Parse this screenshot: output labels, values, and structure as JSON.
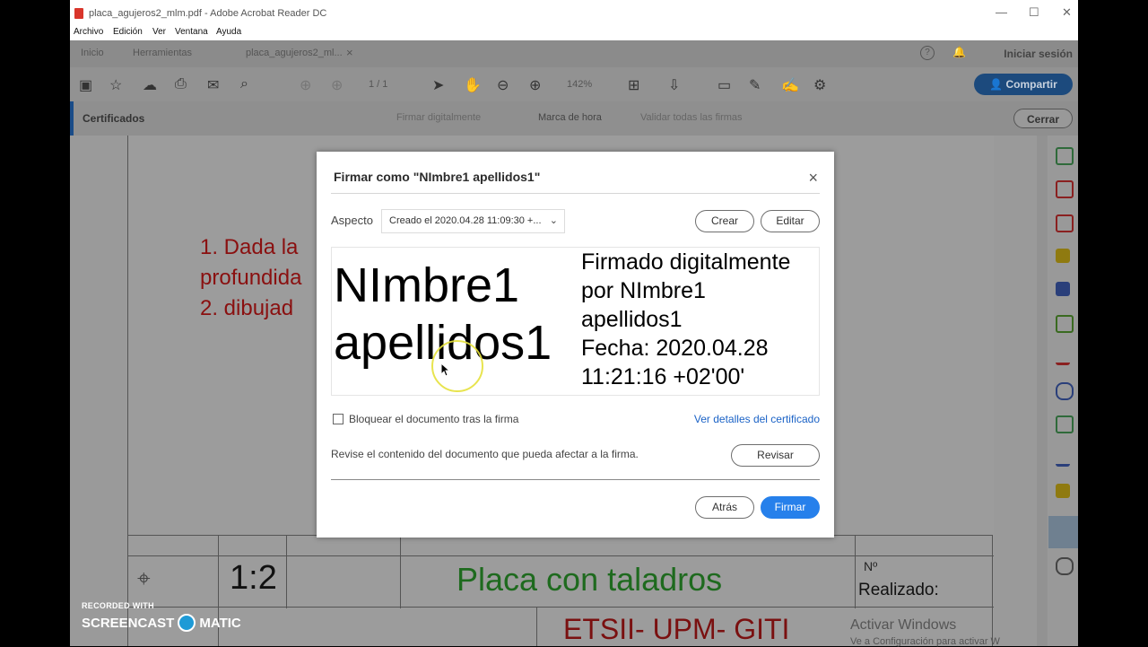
{
  "window": {
    "title": "placa_agujeros2_mlm.pdf - Adobe Acrobat Reader DC",
    "controls": [
      "—",
      "☐",
      "✕"
    ]
  },
  "menu": [
    "Archivo",
    "Edición",
    "Ver",
    "Ventana",
    "Ayuda"
  ],
  "tabs": {
    "home": "Inicio",
    "tools": "Herramientas",
    "document": "placa_agujeros2_ml...",
    "close": "×",
    "login": "Iniciar sesión"
  },
  "toolbar": {
    "page_display": "1 / 1",
    "zoom": "142%",
    "share_label": "Compartir"
  },
  "certbar": {
    "label": "Certificados",
    "item1": "Firmar digitalmente",
    "item2": "Marca de hora",
    "item3": "Validar todas las firmas",
    "close_label": "Cerrar"
  },
  "document": {
    "line1": "1. Dada la",
    "line2": "profundida",
    "line3": "2. dibujad",
    "scale": "1:2",
    "title": "Placa con taladros",
    "number_label": "Nº",
    "made_by": "Realizado:",
    "school": "ETSII- UPM- GITI"
  },
  "dialog": {
    "title": "Firmar como \"NImbre1 apellidos1\"",
    "close": "×",
    "aspect_label": "Aspecto",
    "aspect_value": "Creado el 2020.04.28 11:09:30 +...",
    "create_label": "Crear",
    "edit_label": "Editar",
    "signature_name_line1": "NImbre1",
    "signature_name_line2": "apellidos1",
    "signature_info": [
      "Firmado digitalmente",
      "por NImbre1",
      "apellidos1",
      "Fecha: 2020.04.28",
      "11:21:16 +02'00'"
    ],
    "lock_label": "Bloquear el documento tras la firma",
    "lock_checked": false,
    "cert_link": "Ver detalles del certificado",
    "review_text": "Revise el contenido del documento que pueda afectar a la firma.",
    "review_label": "Revisar",
    "back_label": "Atrás",
    "sign_label": "Firmar"
  },
  "os": {
    "activate_title": "Activar Windows",
    "activate_sub": "Ve a Configuración para activar W"
  },
  "watermark": {
    "recorded": "RECORDED WITH",
    "brand_left": "SCREENCAST",
    "brand_right": "MATIC"
  },
  "colors": {
    "accent": "#2680eb",
    "link": "#1a62c6",
    "share": "#1c4a7d"
  }
}
